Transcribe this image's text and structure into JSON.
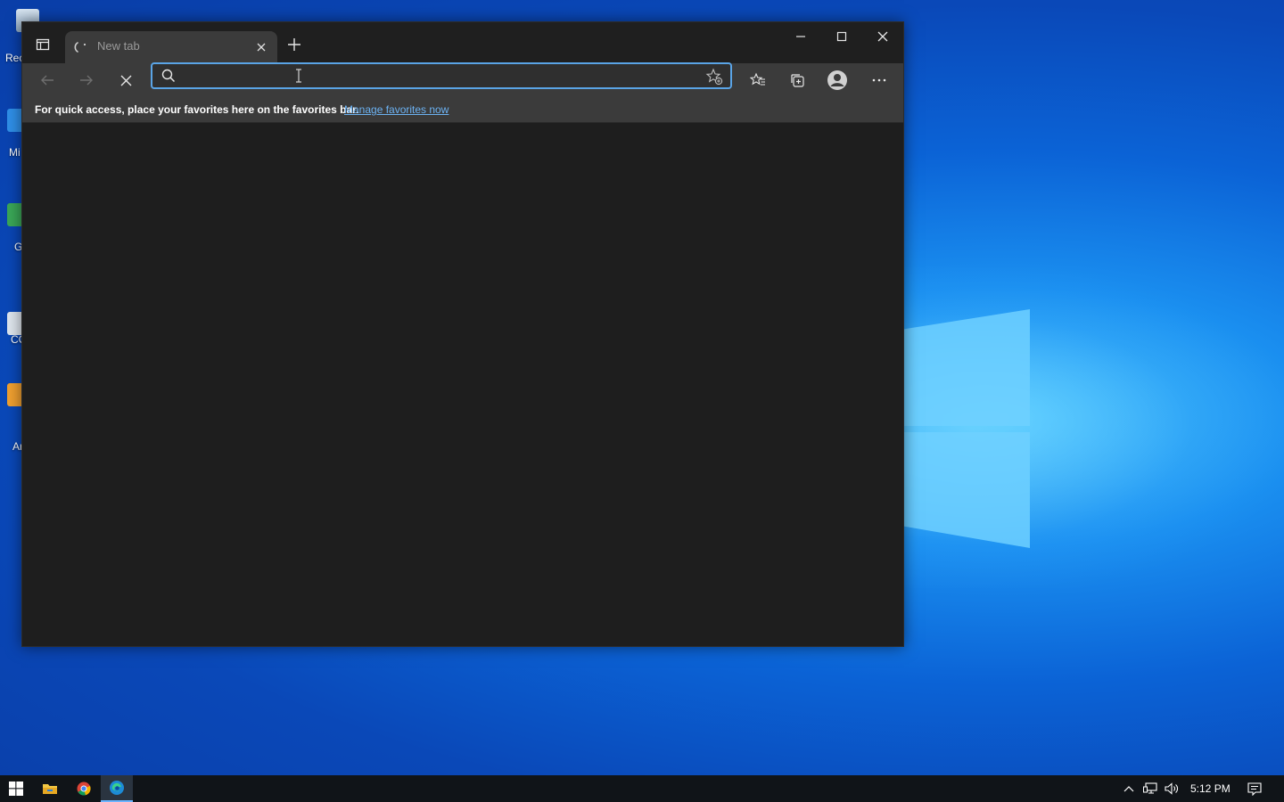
{
  "desktop": {
    "icon_labels": [
      "Rec",
      "Mi",
      "G",
      "C",
      "CC",
      "Ar"
    ]
  },
  "browser": {
    "tab": {
      "title": "New tab"
    },
    "address": {
      "value": "",
      "placeholder": ""
    },
    "favorites_bar": {
      "message": "For quick access, place your favorites here on the favorites bar.",
      "link": "Manage favorites now"
    },
    "colors": {
      "frame": "#1f1f1f",
      "toolbar": "#3b3b3b",
      "content": "#1e1e1e",
      "focus_ring": "#5aa4e6",
      "link": "#6cb2f2"
    }
  },
  "taskbar": {
    "clock": "5:12 PM",
    "pinned": [
      "windows-start-icon",
      "file-explorer-icon",
      "chrome-icon",
      "edge-icon"
    ],
    "tray": [
      "chevron-up-icon",
      "network-icon",
      "volume-icon",
      "notification-icon"
    ]
  }
}
